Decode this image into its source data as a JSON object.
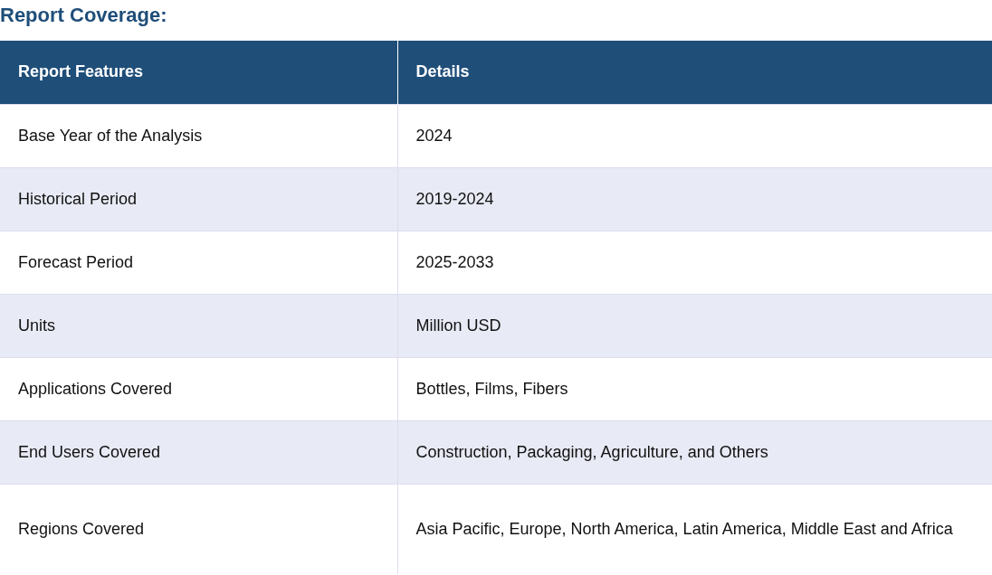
{
  "heading": "Report Coverage:",
  "table": {
    "columns": [
      "Report Features",
      "Details"
    ],
    "rows": [
      {
        "feature": "Base Year of the Analysis",
        "details": "2024"
      },
      {
        "feature": "Historical Period",
        "details": "2019-2024"
      },
      {
        "feature": "Forecast Period",
        "details": "2025-2033"
      },
      {
        "feature": "Units",
        "details": "Million USD"
      },
      {
        "feature": "Applications Covered",
        "details": "Bottles, Films, Fibers"
      },
      {
        "feature": "End Users Covered",
        "details": "Construction, Packaging, Agriculture, and Others"
      },
      {
        "feature": "Regions Covered",
        "details": "Asia Pacific, Europe, North America, Latin America, Middle East and Africa"
      }
    ]
  }
}
